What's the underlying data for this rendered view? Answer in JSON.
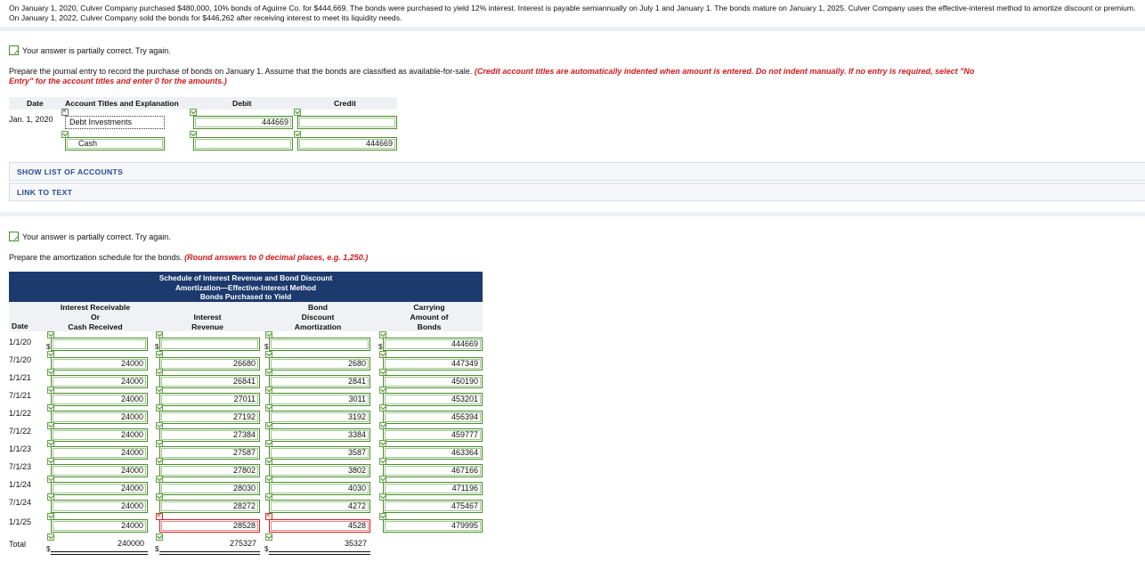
{
  "problem_text": "On January 1, 2020, Culver Company purchased $480,000, 10% bonds of Aguirre Co. for $444,669. The bonds were purchased to yield 12% interest. Interest is payable semiannually on July 1 and January 1. The bonds mature on January 1, 2025. Culver Company uses the effective-interest method to amortize discount or premium. On January 1, 2022, Culver Company sold the bonds for $446,262 after receiving interest to meet its liquidity needs.",
  "part1": {
    "feedback": "Your answer is partially correct.  Try again.",
    "instruction": "Prepare the journal entry to record the purchase of bonds on January 1. Assume that the bonds are classified as available-for-sale.",
    "instruction_red_1": "(Credit account titles are automatically indented when amount is entered. Do not indent manually. If no entry is required, select \"No",
    "instruction_red_2": "Entry\" for the account titles and enter 0 for the amounts.)",
    "headers": {
      "date": "Date",
      "account": "Account Titles and Explanation",
      "debit": "Debit",
      "credit": "Credit"
    },
    "rows": [
      {
        "date": "Jan. 1, 2020",
        "account": "Debt Investments",
        "debit": "444669",
        "credit": ""
      },
      {
        "date": "",
        "account": "Cash",
        "debit": "",
        "credit": "444669"
      }
    ],
    "show_accounts": "SHOW LIST OF ACCOUNTS",
    "link_to_text": "LINK TO TEXT"
  },
  "part2": {
    "feedback": "Your answer is partially correct.  Try again.",
    "instruction": "Prepare the amortization schedule for the bonds.",
    "instruction_red": "(Round answers to 0 decimal places, e.g. 1,250.)",
    "title_1": "Schedule of Interest Revenue and Bond Discount",
    "title_2": "Amortization—Effective-Interest Method",
    "title_3": "Bonds Purchased to Yield",
    "col_date": "Date",
    "col_cash_1": "Interest Receivable",
    "col_cash_2": "Or",
    "col_cash_3": "Cash Received",
    "col_int_1": "Interest",
    "col_int_2": "Revenue",
    "col_amort_1": "Bond",
    "col_amort_2": "Discount",
    "col_amort_3": "Amortization",
    "col_carry_1": "Carrying",
    "col_carry_2": "Amount of",
    "col_carry_3": "Bonds",
    "dollar": "$",
    "rows": [
      {
        "date": "1/1/20",
        "cash": "",
        "interest": "",
        "amort": "",
        "carrying": "444669"
      },
      {
        "date": "7/1/20",
        "cash": "24000",
        "interest": "26680",
        "amort": "2680",
        "carrying": "447349"
      },
      {
        "date": "1/1/21",
        "cash": "24000",
        "interest": "26841",
        "amort": "2841",
        "carrying": "450190"
      },
      {
        "date": "7/1/21",
        "cash": "24000",
        "interest": "27011",
        "amort": "3011",
        "carrying": "453201"
      },
      {
        "date": "1/1/22",
        "cash": "24000",
        "interest": "27192",
        "amort": "3192",
        "carrying": "456394"
      },
      {
        "date": "7/1/22",
        "cash": "24000",
        "interest": "27384",
        "amort": "3384",
        "carrying": "459777"
      },
      {
        "date": "1/1/23",
        "cash": "24000",
        "interest": "27587",
        "amort": "3587",
        "carrying": "463364"
      },
      {
        "date": "7/1/23",
        "cash": "24000",
        "interest": "27802",
        "amort": "3802",
        "carrying": "467166"
      },
      {
        "date": "1/1/24",
        "cash": "24000",
        "interest": "28030",
        "amort": "4030",
        "carrying": "471196"
      },
      {
        "date": "7/1/24",
        "cash": "24000",
        "interest": "28272",
        "amort": "4272",
        "carrying": "475467"
      },
      {
        "date": "1/1/25",
        "cash": "24000",
        "interest": "28528",
        "amort": "4528",
        "carrying": "479995"
      }
    ],
    "total": {
      "label": "Total",
      "cash": "240000",
      "interest": "275327",
      "amort": "35327"
    }
  },
  "colors": {
    "correct": "#4a8c2a",
    "incorrect": "#d21b1b",
    "header_bg": "#1d3a6e",
    "link": "#2b4e8c"
  }
}
